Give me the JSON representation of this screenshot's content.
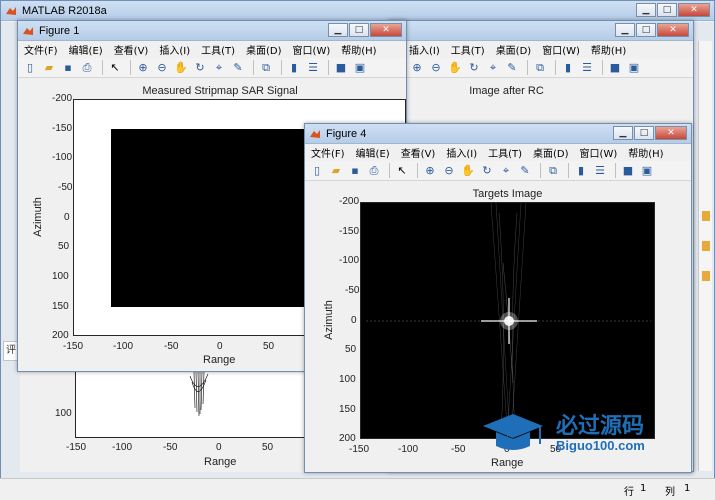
{
  "main_window": {
    "title": "MATLAB R2018a"
  },
  "menus": [
    "文件(F)",
    "编辑(E)",
    "查看(V)",
    "插入(I)",
    "工具(T)",
    "桌面(D)",
    "窗口(W)",
    "帮助(H)"
  ],
  "figure1": {
    "title": "Figure 1",
    "plot_title": "Measured Stripmap SAR Signal",
    "xlabel": "Range",
    "ylabel": "Azimuth",
    "xticks": [
      "-150",
      "-100",
      "-50",
      "0",
      "50"
    ],
    "yticks": [
      "-200",
      "-150",
      "-100",
      "-50",
      "0",
      "50",
      "100",
      "150",
      "200"
    ]
  },
  "figure2": {
    "plot_title": "Image after RC",
    "xlabel": "Range",
    "xticks": [
      "-150",
      "-100",
      "-50",
      "0",
      "50"
    ],
    "yticks": [
      "100"
    ]
  },
  "figure4": {
    "title": "Figure 4",
    "plot_title": "Targets Image",
    "xlabel": "Range",
    "ylabel": "Azimuth",
    "xticks": [
      "-150",
      "-100",
      "-50",
      "0",
      "50"
    ],
    "yticks": [
      "-200",
      "-150",
      "-100",
      "-50",
      "0",
      "50",
      "100",
      "150",
      "200"
    ]
  },
  "sidebar_fragment": "评",
  "status": {
    "row_label": "行",
    "row_value": "1",
    "col_label": "列",
    "col_value": "1"
  },
  "watermark": {
    "text": "必过源码",
    "url": "Biguo100.com"
  },
  "colors": {
    "desktop": "#6b9ecb",
    "titlebar": "#b5cde8",
    "plot_fill": "#000000"
  }
}
